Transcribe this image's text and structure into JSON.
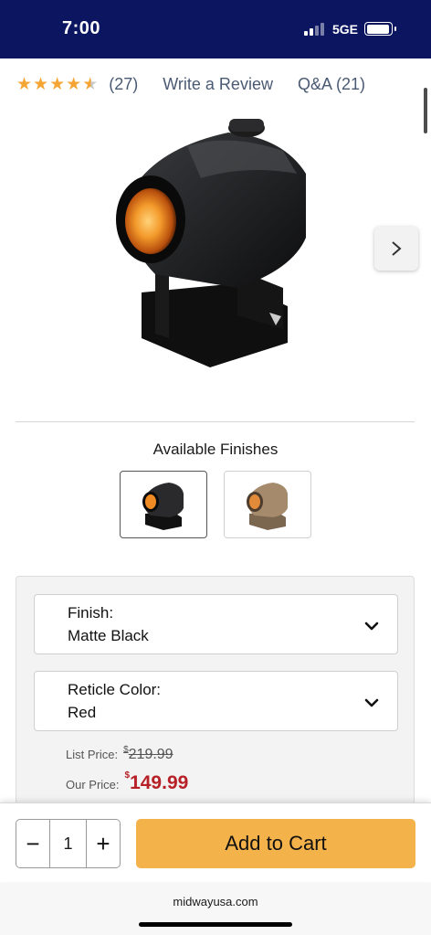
{
  "status_bar": {
    "time": "7:00",
    "network": "5GE"
  },
  "rating": {
    "stars": 4.5,
    "review_count": "(27)",
    "write_review": "Write a Review",
    "qa": "Q&A (21)"
  },
  "hero": {
    "next_icon": "chevron-right-icon"
  },
  "finishes": {
    "heading": "Available Finishes",
    "options": [
      "Matte Black",
      "Flat Dark Earth"
    ],
    "selected_index": 0
  },
  "options": {
    "finish": {
      "label": "Finish:",
      "value": "Matte Black"
    },
    "reticle": {
      "label": "Reticle Color:",
      "value": "Red"
    }
  },
  "price": {
    "list_label": "List Price:",
    "list_currency": "$",
    "list_value": "219.99",
    "our_label": "Our Price:",
    "our_currency": "$",
    "our_value": "149.99"
  },
  "cart": {
    "minus": "−",
    "quantity": "1",
    "plus": "+",
    "add_label": "Add to Cart"
  },
  "url": "midwayusa.com",
  "colors": {
    "status_bar": "#0c1660",
    "star": "#f4a533",
    "link": "#4a5a73",
    "price_red": "#b62026",
    "cart_button": "#f4b24a"
  }
}
